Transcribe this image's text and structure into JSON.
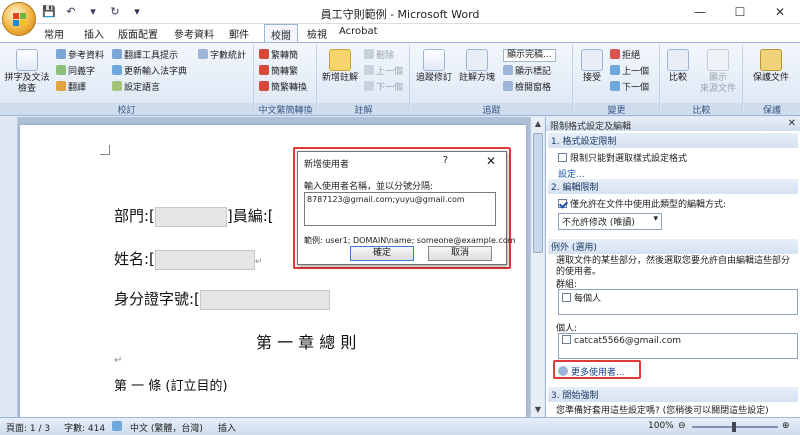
{
  "window": {
    "title": "員工守則範例 - Microsoft Word"
  },
  "qat": {
    "save_icon": "💾",
    "undo_icon": "↶",
    "undo_drop": "▾",
    "redo_icon": "↻",
    "more_icon": "▾"
  },
  "winctl": {
    "min": "—",
    "max": "☐",
    "close": "✕"
  },
  "tabs": [
    "常用",
    "插入",
    "版面配置",
    "參考資料",
    "郵件",
    "校閱",
    "檢視",
    "Acrobat"
  ],
  "active_tab": "校閱",
  "ribbon": {
    "proofing": {
      "spell": "拼字及文法\n檢查",
      "research": "參考資料",
      "thesaurus": "同義字",
      "translate": "翻譯",
      "translate_tip": "翻譯工具提示",
      "update_ime": "更新輸入法字典",
      "set_lang": "設定語言",
      "word_count": "字數統計",
      "label": "校訂"
    },
    "chinese": {
      "t2s": "繁轉簡",
      "s2t": "簡轉繁",
      "convert": "簡繁轉換",
      "label": "中文繁簡轉換"
    },
    "comments": {
      "new": "新增註解",
      "delete": "刪除",
      "prev": "上一個",
      "next": "下一個",
      "label": "註解"
    },
    "tracking": {
      "track": "追蹤修訂",
      "balloon": "註解方塊",
      "display": "顯示完稿...",
      "show_markup": "顯示標記",
      "pane": "檢閱窗格",
      "label": "追蹤"
    },
    "changes": {
      "accept": "接受",
      "reject": "拒絕",
      "prev": "上一個",
      "next": "下一個",
      "label": "變更"
    },
    "compare": {
      "compare": "比較",
      "show_source": "顯示\n來源文件",
      "label": "比較"
    },
    "protect": {
      "protect": "保護文件",
      "label": "保護"
    }
  },
  "document": {
    "line1_dept": "部門:[",
    "line1_emp": "]員編:[",
    "line2": "姓名:[",
    "line3": "身分證字號:[",
    "chapter": "第 一 章 總   則",
    "article": "第  一  條  (訂立目的)",
    "para_mark": "↵"
  },
  "dialog": {
    "title": "新增使用者",
    "help": "?",
    "close": "✕",
    "label": "輸入使用者名稱，並以分號分隔:",
    "input_value": "8787123@gmail.com;yuyu@gmail.com",
    "example": "範例: user1; DOMAIN\\name; someone@example.com",
    "ok": "確定",
    "cancel": "取消"
  },
  "pane": {
    "header": "限制格式設定及編輯",
    "close": "✕",
    "sec1_title": "1. 格式設定限制",
    "sec1_check": "限制只能對選取樣式設定格式",
    "sec1_link": "設定...",
    "sec2_title": "2. 編輯限制",
    "sec2_check": "僅允許在文件中使用此類型的編輯方式:",
    "sec2_select": "不允許修改 (唯讀)",
    "exceptions_title": "例外 (選用)",
    "exceptions_desc": "選取文件的某些部分，然後選取您要允許自由編輯這些部分的使用者。",
    "groups_label": "群組:",
    "group_item": "每個人",
    "individuals_label": "個人:",
    "individual_item": "catcat5566@gmail.com",
    "more_users": "更多使用者...",
    "sec3_title": "3. 開始強制",
    "sec3_text": "您準備好套用這些設定嗎? (您稍後可以關閉這些設定)"
  },
  "status": {
    "page": "頁面: 1 / 3",
    "words": "字數: 414",
    "lang": "中文 (繁體，台灣)",
    "mode": "插入",
    "zoom": "100%",
    "minus": "⊖",
    "plus": "⊕"
  }
}
